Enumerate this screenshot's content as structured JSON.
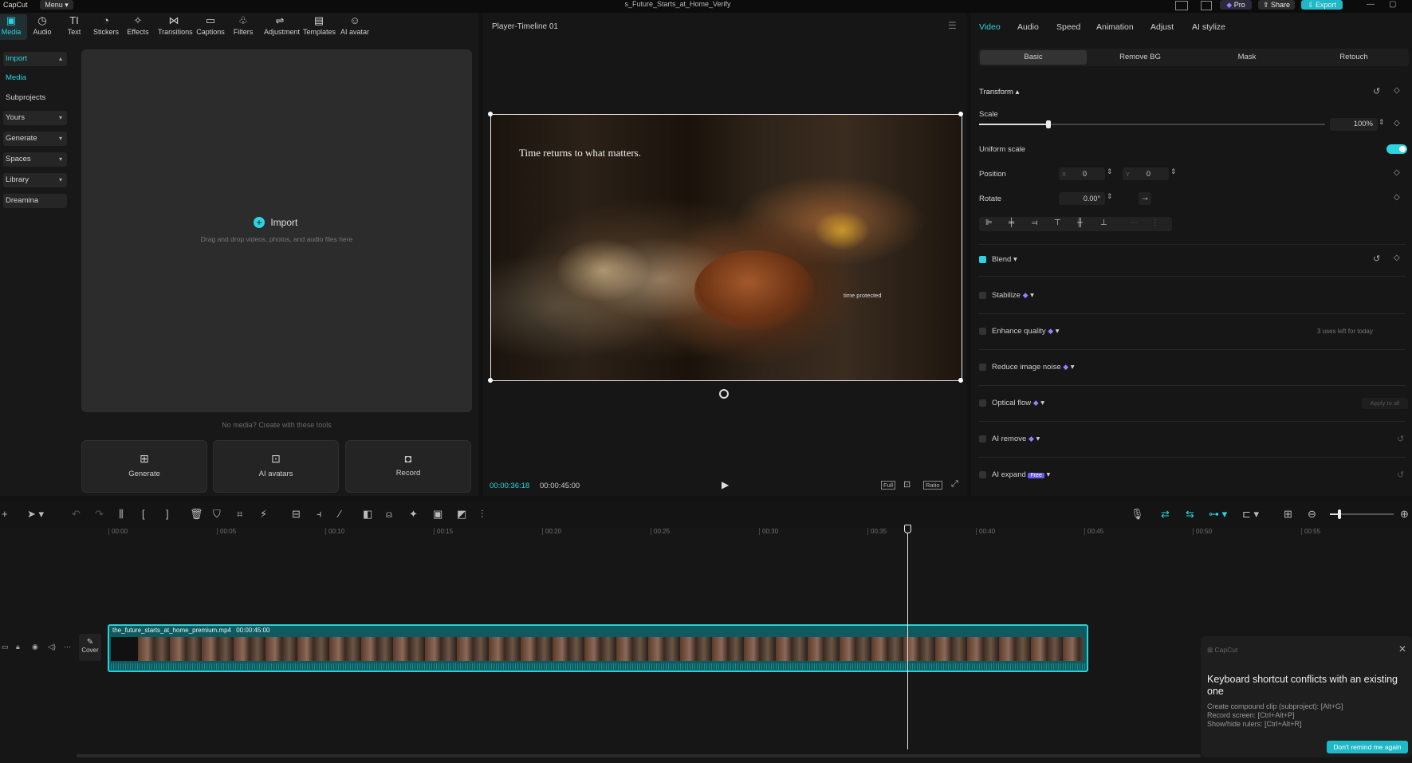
{
  "titlebar": {
    "app_name": "CapCut",
    "menu_label": "Menu",
    "project_title": "s_Future_Starts_at_Home_Verify",
    "pro_label": "Pro",
    "share_label": "Share",
    "export_label": "Export"
  },
  "toolbar": {
    "tools": [
      {
        "label": "Media",
        "icon": "media-icon"
      },
      {
        "label": "Audio",
        "icon": "audio-icon"
      },
      {
        "label": "Text",
        "icon": "text-icon"
      },
      {
        "label": "Stickers",
        "icon": "stickers-icon"
      },
      {
        "label": "Effects",
        "icon": "effects-icon"
      },
      {
        "label": "Transitions",
        "icon": "transitions-icon"
      },
      {
        "label": "Captions",
        "icon": "captions-icon"
      },
      {
        "label": "Filters",
        "icon": "filters-icon"
      },
      {
        "label": "Adjustment",
        "icon": "adjustment-icon"
      },
      {
        "label": "Templates",
        "icon": "templates-icon"
      },
      {
        "label": "AI avatar",
        "icon": "ai-avatar-icon"
      }
    ]
  },
  "leftnav": {
    "items": [
      {
        "label": "Import"
      },
      {
        "label": "Media"
      },
      {
        "label": "Subprojects"
      },
      {
        "label": "Yours"
      },
      {
        "label": "Generate"
      },
      {
        "label": "Spaces"
      },
      {
        "label": "Library"
      },
      {
        "label": "Dreamina"
      }
    ]
  },
  "media": {
    "import_label": "Import",
    "import_hint": "Drag and drop videos, photos, and audio files here",
    "no_media_text": "No media? Create with these tools",
    "cards": [
      {
        "label": "Generate"
      },
      {
        "label": "AI avatars"
      },
      {
        "label": "Record"
      }
    ]
  },
  "player": {
    "title": "Player-Timeline 01",
    "overlay_text": "Time returns to what matters.",
    "inner_text": "time protected",
    "current_time": "00:00:36:18",
    "total_time": "00:00:45:00",
    "btn_full": "Full",
    "btn_ratio": "Ratio"
  },
  "props": {
    "tabs": [
      "Video",
      "Audio",
      "Speed",
      "Animation",
      "Adjust",
      "AI stylize"
    ],
    "subtabs": [
      "Basic",
      "Remove BG",
      "Mask",
      "Retouch"
    ],
    "transform_label": "Transform",
    "scale_label": "Scale",
    "scale_value": "100%",
    "scale_fraction": 0.2,
    "uniform_scale_label": "Uniform scale",
    "position_label": "Position",
    "x_label": "X",
    "x_value": "0",
    "y_label": "Y",
    "y_value": "0",
    "rotate_label": "Rotate",
    "rotate_value": "0.00°",
    "blend_label": "Blend",
    "stabilize_label": "Stabilize",
    "enhance_label": "Enhance quality",
    "enhance_note": "3 uses left for today",
    "reduce_noise_label": "Reduce image noise",
    "optical_flow_label": "Optical flow",
    "apply_all_label": "Apply to all",
    "ai_remove_label": "AI remove",
    "ai_expand_label": "AI expand",
    "free_badge": "Free"
  },
  "timeline": {
    "ticks": [
      "00:00",
      "00:05",
      "00:10",
      "00:15",
      "00:20",
      "00:25",
      "00:30",
      "00:35",
      "00:40",
      "00:45",
      "00:50",
      "00:55"
    ],
    "clip_name": "the_future_starts_at_home_premium.mp4",
    "clip_duration": "00:00:45:00",
    "cover_label": "Cover"
  },
  "toast": {
    "app_name": "CapCut",
    "title": "Keyboard shortcut conflicts with an existing one",
    "lines": [
      "Create compound clip (subproject): [Alt+G]",
      "Record screen: [Ctrl+Alt+P]",
      "Show/hide rulers: [Ctrl+Alt+R]"
    ],
    "button_label": "Don't remind me again"
  },
  "colors": {
    "accent": "#2bd4e0",
    "background": "#121212",
    "panel": "#181818"
  }
}
